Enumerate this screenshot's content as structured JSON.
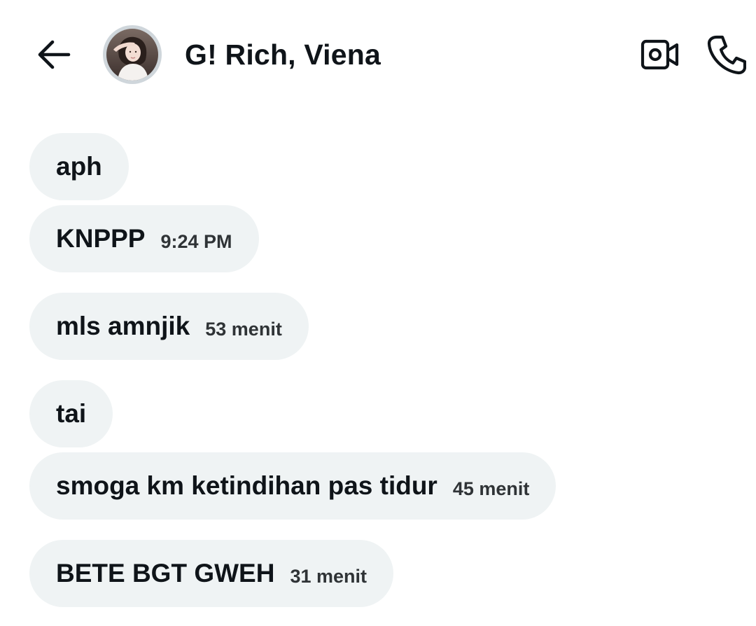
{
  "header": {
    "title": "G! Rich, Viena",
    "back_icon": "arrow-left-icon",
    "video_icon": "video-camera-icon",
    "call_icon": "phone-icon"
  },
  "colors": {
    "bubble_bg": "#eff3f4",
    "text": "#0f1419",
    "timestamp": "#2f3336",
    "avatar_ring": "#cfd6db"
  },
  "messages": [
    {
      "text": "aph",
      "time": ""
    },
    {
      "text": "KNPPP",
      "time": "9:24 PM"
    },
    {
      "text": "mls amnjik",
      "time": "53 menit"
    },
    {
      "text": "tai",
      "time": ""
    },
    {
      "text": "smoga km ketindihan pas tidur",
      "time": "45 menit"
    },
    {
      "text": "BETE BGT GWEH",
      "time": "31 menit"
    }
  ]
}
